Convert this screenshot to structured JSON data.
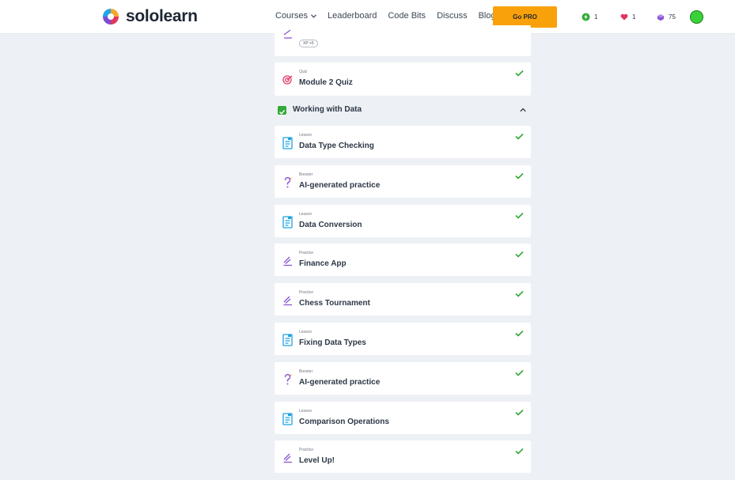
{
  "brand": {
    "name": "sololearn"
  },
  "nav": {
    "courses": "Courses",
    "leaderboard": "Leaderboard",
    "code_bits": "Code Bits",
    "discuss": "Discuss",
    "blog": "Blog"
  },
  "go_pro": "Go PRO",
  "stats": {
    "streak": "1",
    "hearts": "1",
    "gems": "75"
  },
  "top_card": {
    "xp_chip": "XP +5"
  },
  "quiz_card": {
    "type": "Quiz",
    "title": "Module 2 Quiz"
  },
  "section": {
    "title": "Working with Data"
  },
  "items": [
    {
      "type": "Lesson",
      "title": "Data Type Checking",
      "icon": "lesson-icon"
    },
    {
      "type": "Booster",
      "title": "AI-generated practice",
      "icon": "booster-icon"
    },
    {
      "type": "Lesson",
      "title": "Data Conversion",
      "icon": "lesson-icon"
    },
    {
      "type": "Practice",
      "title": "Finance App",
      "icon": "practice-icon"
    },
    {
      "type": "Practice",
      "title": "Chess Tournament",
      "icon": "practice-icon"
    },
    {
      "type": "Lesson",
      "title": "Fixing Data Types",
      "icon": "lesson-icon"
    },
    {
      "type": "Booster",
      "title": "AI-generated practice",
      "icon": "booster-icon"
    },
    {
      "type": "Lesson",
      "title": "Comparison Operations",
      "icon": "lesson-icon"
    },
    {
      "type": "Practice",
      "title": "Level Up!",
      "icon": "practice-icon"
    }
  ],
  "colors": {
    "accent": "#f9a10a",
    "check": "#33a938",
    "lesson": "#1fa2e0",
    "practice": "#8a55d6",
    "quiz": "#e23a64"
  }
}
